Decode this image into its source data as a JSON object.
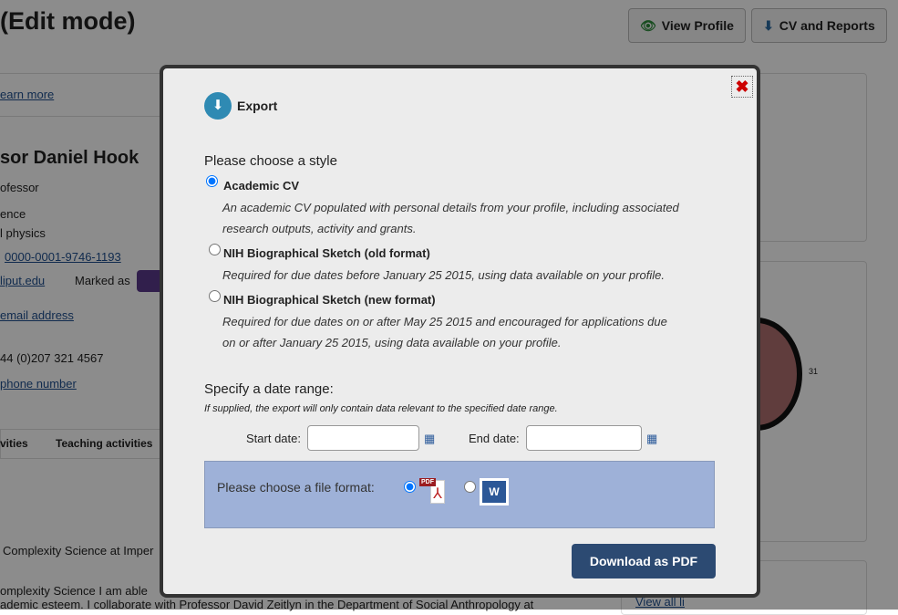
{
  "page": {
    "title": "(Edit mode)",
    "view_profile": "View Profile",
    "cv_reports": "CV and Reports",
    "learn_more": "earn more",
    "name": "sor Daniel Hook",
    "role": "ofessor",
    "dept1": "ence",
    "dept2": "l physics",
    "orcid": "0000-0001-9746-1193",
    "email": "liput.edu",
    "marked_as": "Marked as",
    "add_email": "email address",
    "phone": "44 (0)207 321 4567",
    "add_phone": "phone number",
    "tab1": "vities",
    "tab2": "Teaching activities",
    "body1": "Complexity Science at Imper",
    "body2": "omplexity Science I am able",
    "body3": "ademic esteem. I collaborate with Professor David Zeitlyn in the Department of Social Anthropology at",
    "chart_label": "31",
    "view_all": "View all li"
  },
  "modal": {
    "title": "Export",
    "style_heading": "Please choose a style",
    "styles": [
      {
        "label": "Academic CV",
        "desc1": "An academic CV populated with personal details from your profile, including associated",
        "desc2": "research outputs, activity and grants.",
        "checked": true
      },
      {
        "label": "NIH Biographical Sketch (old format)",
        "desc1": "Required for due dates before January 25 2015, using data available on your profile.",
        "desc2": "",
        "checked": false
      },
      {
        "label": "NIH Biographical Sketch (new format)",
        "desc1": "Required for due dates on or after May 25 2015 and encouraged for applications due",
        "desc2": "on or after January 25 2015, using data available on your profile.",
        "checked": false
      }
    ],
    "date_heading": "Specify a date range:",
    "date_note": "If supplied, the export will only contain data relevant to the specified date range.",
    "start_label": "Start date:",
    "end_label": "End date:",
    "start_value": "",
    "end_value": "",
    "format_label": "Please choose a file format:",
    "pdf_badge": "PDF",
    "word_badge": "W",
    "download": "Download as PDF"
  }
}
